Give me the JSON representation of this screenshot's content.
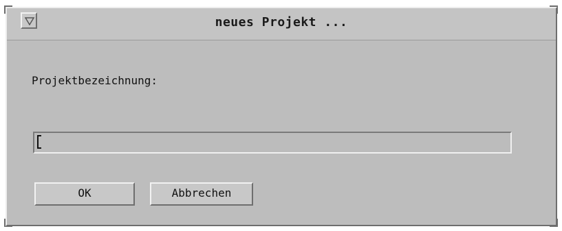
{
  "window": {
    "title": "neues Projekt ..."
  },
  "form": {
    "label": "Projektbezeichnung:",
    "input_value": ""
  },
  "buttons": {
    "ok_label": "OK",
    "cancel_label": "Abbrechen"
  },
  "icons": {
    "window_menu": "triangle-down-icon"
  }
}
